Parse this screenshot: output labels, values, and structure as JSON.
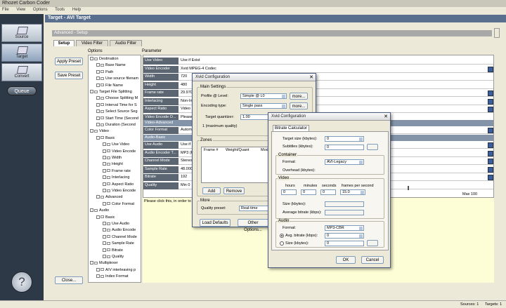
{
  "app": {
    "title": "Rhozet Carbon Coder"
  },
  "menu": [
    "File",
    "View",
    "Options",
    "Tools",
    "Help"
  ],
  "leftbar": {
    "source": "Source",
    "target": "Target",
    "convert": "Convert",
    "queue": "Queue",
    "help": "?"
  },
  "target_header": "Target - AVI Target",
  "advanced_header": "Advanced - Setup",
  "tabs": [
    "Setup",
    "Video Filter",
    "Audio Filter"
  ],
  "buttons": {
    "apply_preset": "Apply Preset",
    "save_preset": "Save Preset",
    "close": "Close..."
  },
  "columns": {
    "options": "Options",
    "parameter": "Parameter"
  },
  "tree": [
    {
      "label": "Destination",
      "level": 1
    },
    {
      "label": "Base Name",
      "level": 2
    },
    {
      "label": "Path",
      "level": 2
    },
    {
      "label": "Use source filenam",
      "level": 2
    },
    {
      "label": "File Name",
      "level": 2
    },
    {
      "label": "Target File Splitting",
      "level": 1
    },
    {
      "label": "Choose Splitting M",
      "level": 2
    },
    {
      "label": "Interval Time for S",
      "level": 2
    },
    {
      "label": "Select Source Seg",
      "level": 2
    },
    {
      "label": "Start Time (Second",
      "level": 2
    },
    {
      "label": "Duration (Second",
      "level": 2
    },
    {
      "label": "Video",
      "level": 1
    },
    {
      "label": "Basic",
      "level": 2
    },
    {
      "label": "Use Video",
      "level": 3
    },
    {
      "label": "Video Encode",
      "level": 3
    },
    {
      "label": "Width",
      "level": 3
    },
    {
      "label": "Height",
      "level": 3
    },
    {
      "label": "Frame rate",
      "level": 3
    },
    {
      "label": "Interlacing",
      "level": 3
    },
    {
      "label": "Aspect Ratio",
      "level": 3
    },
    {
      "label": "Video Encode",
      "level": 3
    },
    {
      "label": "Advanced",
      "level": 2
    },
    {
      "label": "Color Format",
      "level": 3
    },
    {
      "label": "Audio",
      "level": 1
    },
    {
      "label": "Basic",
      "level": 2
    },
    {
      "label": "Use Audio",
      "level": 3
    },
    {
      "label": "Audio Encode",
      "level": 3
    },
    {
      "label": "Channel Mode",
      "level": 3
    },
    {
      "label": "Sample Rate",
      "level": 3
    },
    {
      "label": "Bitrate",
      "level": 3
    },
    {
      "label": "Quality",
      "level": 3
    },
    {
      "label": "Multiplexer",
      "level": 1
    },
    {
      "label": "A/V interleaving p",
      "level": 2
    },
    {
      "label": "Index Format",
      "level": 2
    }
  ],
  "params": [
    {
      "label": "Use Video",
      "value": "Use if Exist"
    },
    {
      "label": "Video Encoder",
      "value": "Xvid MPEG-4 Codec"
    },
    {
      "label": "Width",
      "value": "720"
    },
    {
      "label": "Height",
      "value": "480"
    },
    {
      "label": "Frame rate",
      "value": "29.970"
    },
    {
      "label": "Interlacing",
      "value": "Non-Int"
    },
    {
      "label": "Aspect Ratio",
      "value": "Video"
    },
    {
      "label": "Video Encode O...",
      "value": "Please c"
    }
  ],
  "section_video_adv": "Video-Advanced",
  "param_color": {
    "label": "Color Format",
    "value": "Automa"
  },
  "section_audio_basic": "Audio-Basic",
  "params_audio": [
    {
      "label": "Use Audio",
      "value": "Use if E"
    },
    {
      "label": "Audio Encoder T...",
      "value": "MP3 (F"
    },
    {
      "label": "Channel Mode",
      "value": "Stereo"
    },
    {
      "label": "Sample Rate",
      "value": "48.000"
    },
    {
      "label": "Bitrate",
      "value": "192"
    },
    {
      "label": "Quality",
      "value": "Min 0"
    }
  ],
  "quality_max": "Max 100",
  "description": "Please click this, in order to c",
  "status": {
    "sources": "Sources: 1",
    "targets": "Targets: 1"
  },
  "xvid1": {
    "title": "Xvid Configuration",
    "main_settings": "Main Settings",
    "profile_label": "Profile @ Level:",
    "profile_value": "Simple @ L0",
    "more": "more...",
    "encoding_label": "Encoding type:",
    "encoding_value": "Single pass",
    "quantizer_label": "Target quantizer:",
    "quantizer_value": "1.00",
    "quantizer_hint": "1 (maximum quality)",
    "zones": "Zones",
    "zone_cols": [
      "Frame #",
      "Weight/Quant",
      "Modifier"
    ],
    "add": "Add",
    "remove": "Remove",
    "more_group": "More",
    "quality_preset_label": "Quality preset:",
    "quality_preset_value": "Real-time",
    "load_defaults": "Load Defaults",
    "other_options": "Other Options..."
  },
  "xvid2": {
    "title": "Xvid Configuration",
    "tab": "Bitrate Calculator",
    "target_size_label": "Target size (kbytes):",
    "target_size_value": "0",
    "subtitles_label": "Subtitles (kbytes):",
    "subtitles_value": "0",
    "container": "Container",
    "format_label": "Format:",
    "format_value": "AVI-Legacy",
    "overhead_label": "Overhead (kbytes):",
    "video": "Video",
    "time_cols": [
      "hours",
      "minutes",
      "seconds",
      "frames per second"
    ],
    "hours": "0",
    "minutes": "0",
    "seconds": "0",
    "fps": "15.0",
    "size_label": "Size (kbytes):",
    "avg_bitrate_label": "Average bitrate (kbps):",
    "audio": "Audio",
    "audio_format_label": "Format:",
    "audio_format_value": "MP3-CBR",
    "avg_bitrate_radio": "Avg. bitrate (kbps):",
    "avg_bitrate_value": "0",
    "size_radio": "Size (kbytes):",
    "size_value": "0",
    "ok": "OK",
    "cancel": "Cancel"
  }
}
